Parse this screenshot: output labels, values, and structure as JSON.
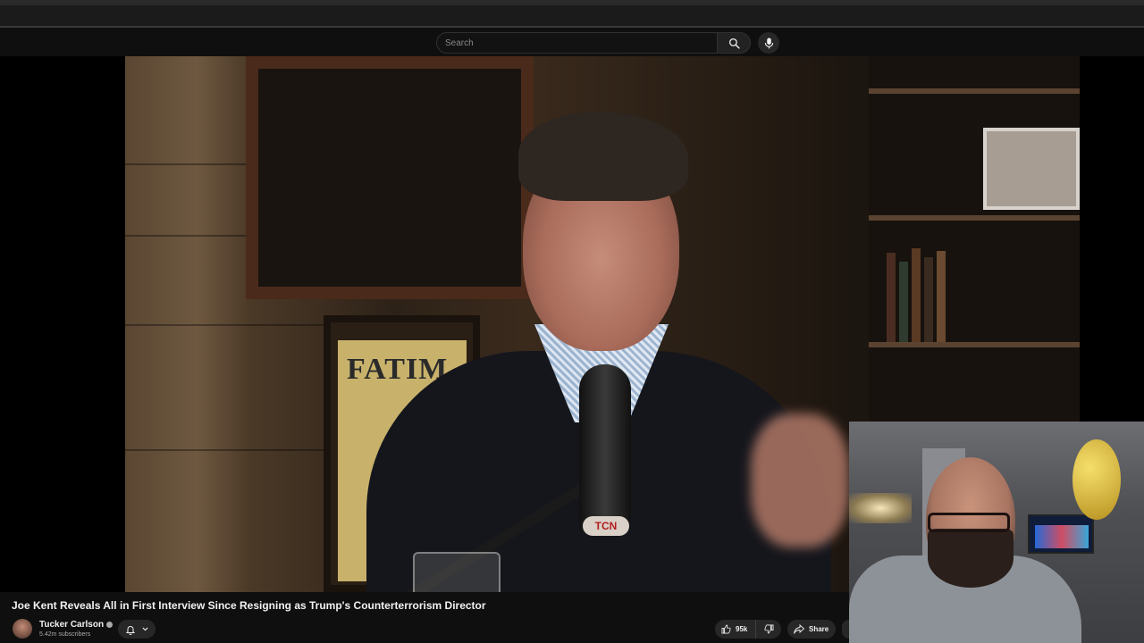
{
  "masthead": {
    "search": {
      "placeholder": "Search",
      "value": ""
    },
    "search_button_icon": "search-icon",
    "voice_button_icon": "microphone-icon"
  },
  "video": {
    "title": "Joe Kent Reveals All in First Interview Since Resigning as Trump's Counterterrorism Director",
    "poster_text": "FATIM",
    "mic_brand": "TCN"
  },
  "channel": {
    "name": "Tucker Carlson",
    "subscribers": "5.42m subscribers",
    "verified": true
  },
  "actions": {
    "likes": "95k",
    "share_label": "Share"
  },
  "colors": {
    "background": "#0f0f0f",
    "button_bg": "#272727",
    "text_primary": "#f1f1f1",
    "text_secondary": "#aaaaaa"
  }
}
